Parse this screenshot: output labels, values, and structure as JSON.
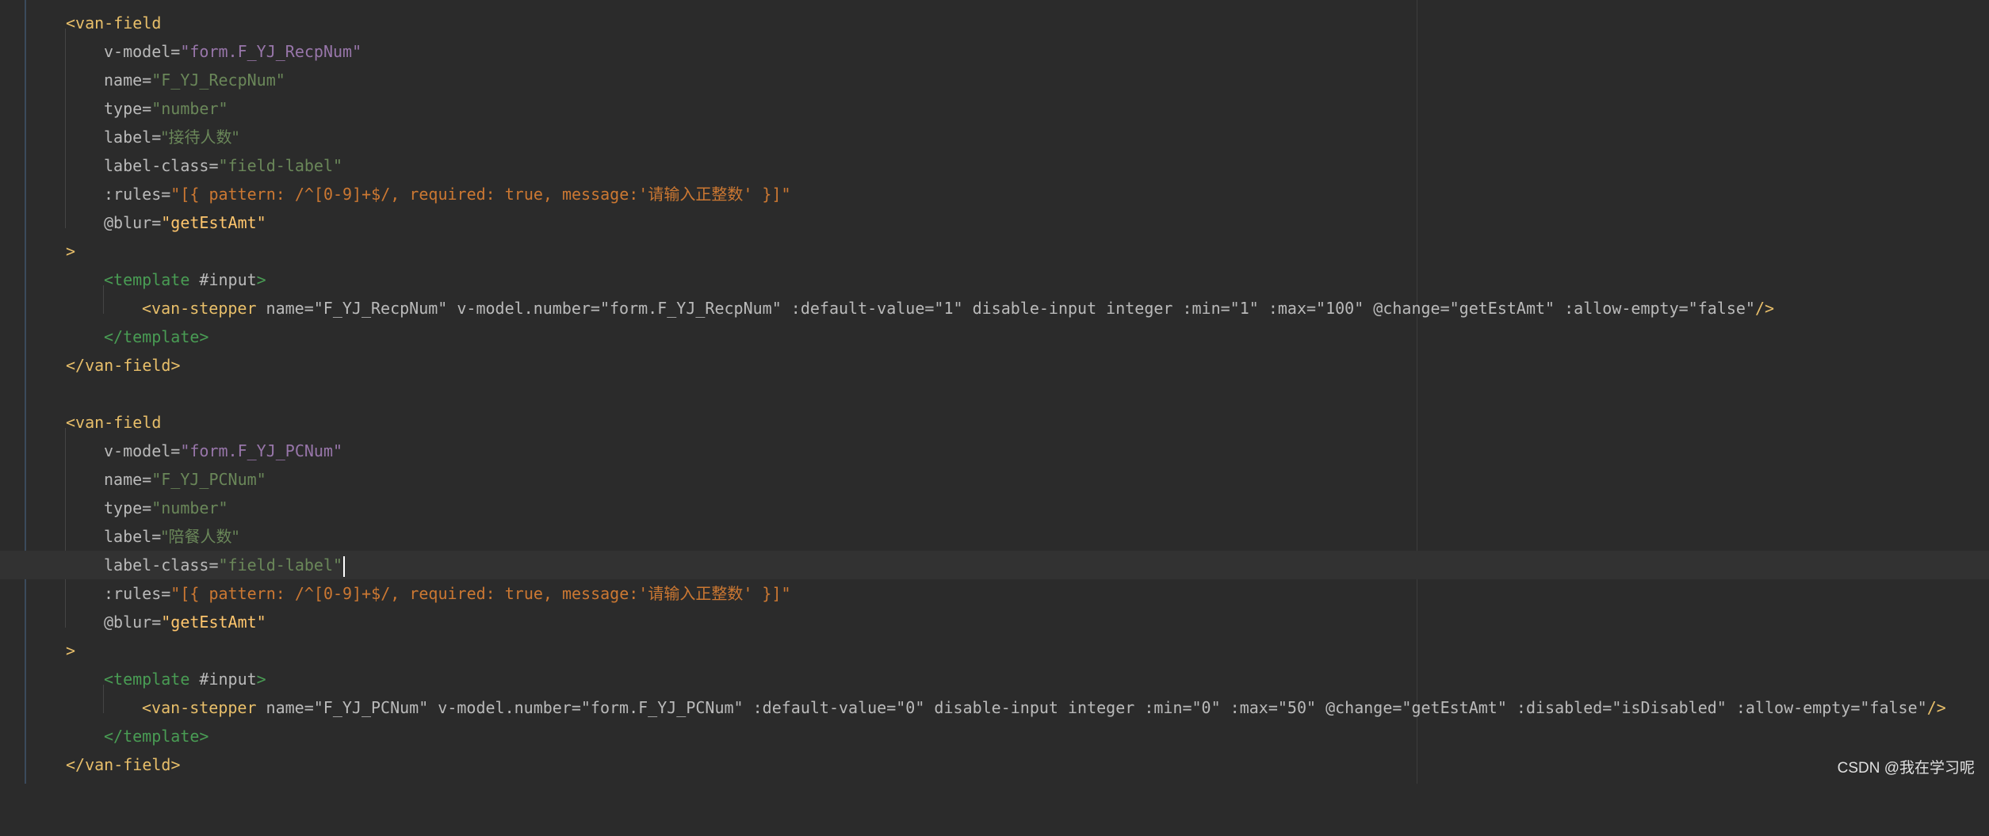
{
  "editor": {
    "lines": [
      [
        "<",
        "van-field",
        ""
      ],
      [
        "v-model=",
        "\"form.F_YJ_RecpNum\"",
        ""
      ],
      [
        "name=",
        "\"F_YJ_RecpNum\"",
        ""
      ],
      [
        "type=",
        "\"number\"",
        ""
      ],
      [
        "label=",
        "\"接待人数\"",
        ""
      ],
      [
        "label-class=",
        "\"field-label\"",
        ""
      ],
      [
        ":rules=",
        "\"[{ pattern: /^[0-9]+$/, required: true, message:'请输入正整数' }]\"",
        ""
      ],
      [
        "@blur=",
        "\"getEstAmt\"",
        ""
      ],
      [
        ">",
        "",
        ""
      ],
      [
        "<template",
        " #input",
        ">"
      ],
      [
        "<van-stepper",
        " name=\"F_YJ_RecpNum\" v-model.number=\"form.F_YJ_RecpNum\" :default-value=\"1\" disable-input integer :min=\"1\" :max=\"100\" @change=\"getEstAmt\" :allow-empty=\"false\"",
        "/>"
      ],
      [
        "</template",
        "",
        ">"
      ],
      [
        "</van-field",
        "",
        ">"
      ],
      [
        "",
        "",
        ""
      ],
      [
        "<",
        "van-field",
        ""
      ],
      [
        "v-model=",
        "\"form.F_YJ_PCNum\"",
        ""
      ],
      [
        "name=",
        "\"F_YJ_PCNum\"",
        ""
      ],
      [
        "type=",
        "\"number\"",
        ""
      ],
      [
        "label=",
        "\"陪餐人数\"",
        ""
      ],
      [
        "label-class=",
        "\"field-label\"",
        ""
      ],
      [
        ":rules=",
        "\"[{ pattern: /^[0-9]+$/, required: true, message:'请输入正整数' }]\"",
        ""
      ],
      [
        "@blur=",
        "\"getEstAmt\"",
        ""
      ],
      [
        ">",
        "",
        ""
      ],
      [
        "<template",
        " #input",
        ">"
      ],
      [
        "<van-stepper",
        " name=\"F_YJ_PCNum\" v-model.number=\"form.F_YJ_PCNum\" :default-value=\"0\" disable-input integer :min=\"0\" :max=\"50\" @change=\"getEstAmt\" :disabled=\"isDisabled\" :allow-empty=\"false\"",
        "/>"
      ],
      [
        "</template",
        "",
        ">"
      ],
      [
        "</van-field",
        "",
        ">"
      ]
    ]
  },
  "watermark": "CSDN @我在学习呢",
  "colors": {
    "background": "#2b2b2b",
    "current_line": "#323232",
    "tag": "#e8bf6a",
    "string": "#6a8759",
    "number": "#6897bb",
    "keyword": "#cc7832",
    "function": "#ffc66d",
    "property": "#9876aa"
  }
}
